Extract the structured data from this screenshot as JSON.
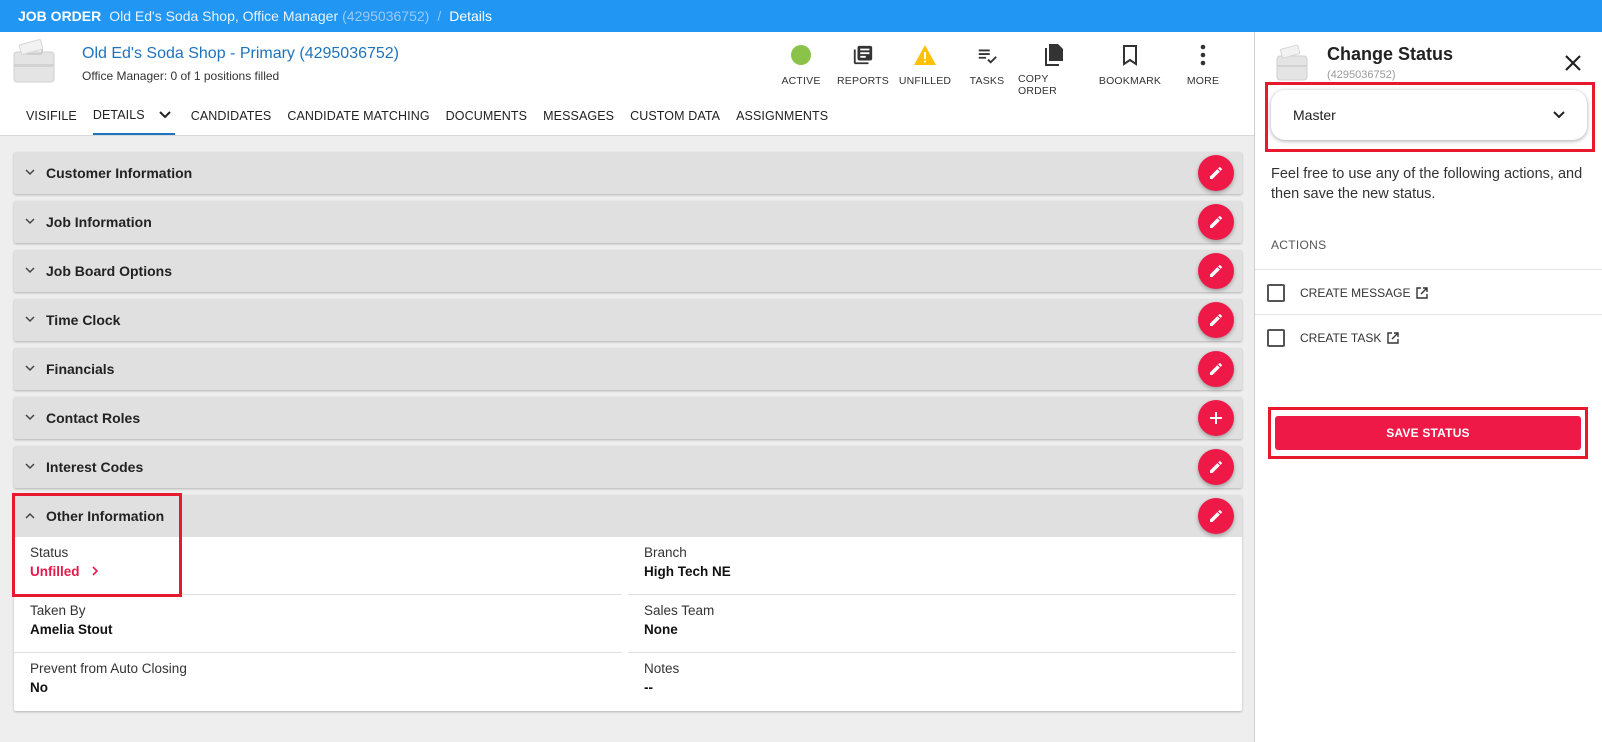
{
  "breadcrumb": {
    "root": "JOB ORDER",
    "sub": "Old Ed's Soda Shop, Office Manager",
    "sub_id": "(4295036752)",
    "sep": "/",
    "current": "Details"
  },
  "record": {
    "title": "Old Ed's Soda Shop - Primary (4295036752)",
    "subtitle": "Office Manager: 0 of 1 positions filled"
  },
  "actions": [
    {
      "label": "ACTIVE",
      "icon": "status-dot-icon",
      "color": "#8bc34a"
    },
    {
      "label": "REPORTS",
      "icon": "reports-icon"
    },
    {
      "label": "UNFILLED",
      "icon": "warning-icon",
      "color": "#ffc107"
    },
    {
      "label": "TASKS",
      "icon": "tasks-icon"
    },
    {
      "label": "COPY ORDER",
      "icon": "copy-icon"
    },
    {
      "label": "BOOKMARK",
      "icon": "bookmark-icon"
    },
    {
      "label": "MORE",
      "icon": "more-vertical-icon"
    }
  ],
  "tabs": [
    {
      "label": "VISIFILE"
    },
    {
      "label": "DETAILS"
    },
    {
      "label": "CANDIDATES"
    },
    {
      "label": "CANDIDATE MATCHING"
    },
    {
      "label": "DOCUMENTS"
    },
    {
      "label": "MESSAGES"
    },
    {
      "label": "CUSTOM DATA"
    },
    {
      "label": "ASSIGNMENTS"
    }
  ],
  "sections": [
    {
      "title": "Customer Information",
      "action": "edit"
    },
    {
      "title": "Job Information",
      "action": "edit"
    },
    {
      "title": "Job Board Options",
      "action": "edit"
    },
    {
      "title": "Time Clock",
      "action": "edit"
    },
    {
      "title": "Financials",
      "action": "edit"
    },
    {
      "title": "Contact Roles",
      "action": "add"
    },
    {
      "title": "Interest Codes",
      "action": "edit"
    }
  ],
  "other_info": {
    "title": "Other Information",
    "fields": [
      {
        "label": "Status",
        "value": "Unfilled",
        "link": true
      },
      {
        "label": "Branch",
        "value": "High Tech NE"
      },
      {
        "label": "Taken By",
        "value": "Amelia Stout"
      },
      {
        "label": "Sales Team",
        "value": "None"
      },
      {
        "label": "Prevent from Auto Closing",
        "value": "No"
      },
      {
        "label": "Notes",
        "value": "--"
      }
    ]
  },
  "panel": {
    "title": "Change Status",
    "id": "(4295036752)",
    "dropdown_value": "Master",
    "description": "Feel free to use any of the following actions, and then save the new status.",
    "actions_heading": "ACTIONS",
    "options": [
      {
        "label": "CREATE MESSAGE",
        "checked": false
      },
      {
        "label": "CREATE TASK",
        "checked": false
      }
    ],
    "save_label": "SAVE STATUS"
  },
  "colors": {
    "topbar": "#2196f3",
    "accent": "#ee1947",
    "link": "#1e73be",
    "highlight": "#e8192c"
  }
}
